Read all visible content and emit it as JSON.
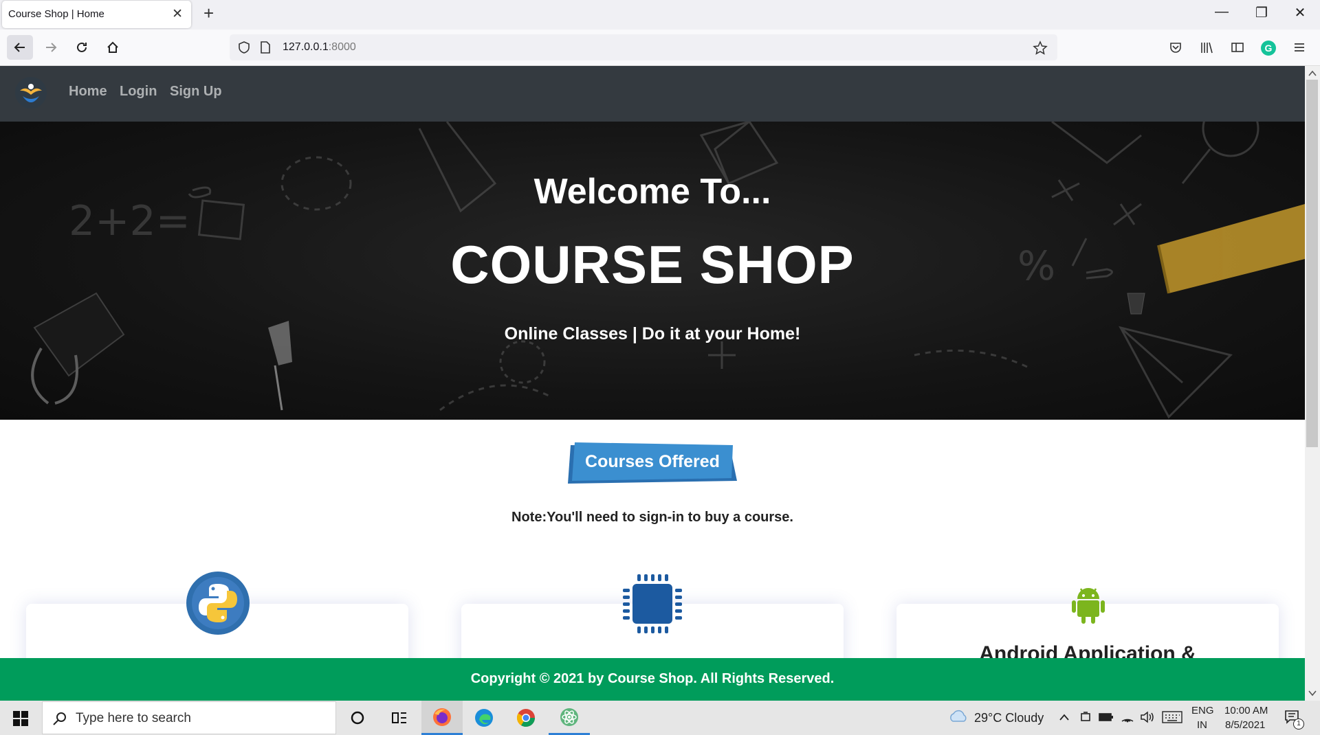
{
  "browser": {
    "tab_title": "Course Shop | Home",
    "url_host": "127.0.0.1",
    "url_port": ":8000"
  },
  "nav": {
    "links": [
      "Home",
      "Login",
      "Sign Up"
    ]
  },
  "hero": {
    "welcome": "Welcome To...",
    "title": "COURSE SHOP",
    "tagline": "Online Classes | Do it at your Home!"
  },
  "courses": {
    "heading": "Courses Offered",
    "note": "Note:You'll need to sign-in to buy a course.",
    "cards": [
      {
        "icon": "python-icon",
        "title": ""
      },
      {
        "icon": "chip-icon",
        "title": ""
      },
      {
        "icon": "android-icon",
        "title": "Android Application &"
      }
    ]
  },
  "footer": {
    "copyright": "Copyright © 2021 by Course Shop. All Rights Reserved."
  },
  "taskbar": {
    "search_placeholder": "Type here to search",
    "weather": "29°C  Cloudy",
    "lang_top": "ENG",
    "lang_bottom": "IN",
    "time": "10:00 AM",
    "date": "8/5/2021",
    "notification_count": "1"
  },
  "colors": {
    "nav_bg": "#343a40",
    "footer_bg": "#009c5b",
    "badge_blue": "#3b8fd0",
    "chip_blue": "#1c5aa0",
    "android_green": "#7cb51e",
    "python_ring": "#2f6fae"
  }
}
